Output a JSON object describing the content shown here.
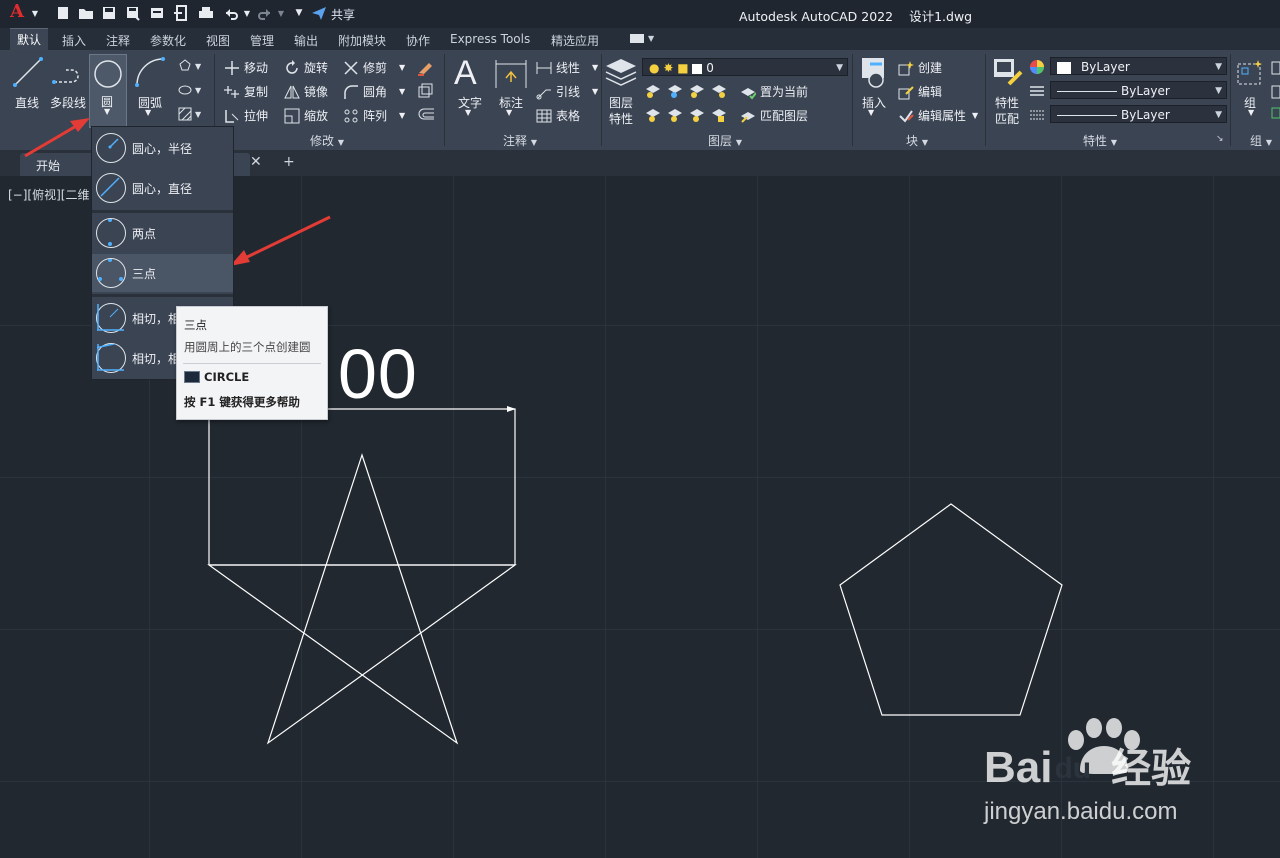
{
  "window": {
    "title": "Autodesk AutoCAD 2022",
    "file": "设计1.dwg",
    "share": "共享"
  },
  "ribbon_tabs": [
    "默认",
    "插入",
    "注释",
    "参数化",
    "视图",
    "管理",
    "输出",
    "附加模块",
    "协作",
    "Express Tools",
    "精选应用"
  ],
  "draw": {
    "line": "直线",
    "polyline": "多段线",
    "circle": "圆",
    "arc": "圆弧"
  },
  "modify": {
    "title": "修改",
    "move": "移动",
    "rotate": "旋转",
    "trim": "修剪",
    "copy": "复制",
    "mirror": "镜像",
    "fillet": "圆角",
    "stretch": "拉伸",
    "scale": "缩放",
    "array": "阵列"
  },
  "annotation": {
    "title": "注释",
    "text": "文字",
    "dimension": "标注",
    "linear": "线性",
    "leader": "引线",
    "table": "表格"
  },
  "layers": {
    "title": "图层",
    "layer_props_1": "图层",
    "layer_props_2": "特性",
    "current_layer": "0",
    "set_current": "置为当前",
    "match_layer": "匹配图层"
  },
  "block": {
    "title": "块",
    "insert": "插入",
    "create": "创建",
    "edit": "编辑",
    "edit_attrs": "编辑属性"
  },
  "properties": {
    "title": "特性",
    "match_1": "特性",
    "match_2": "匹配",
    "color": "ByLayer",
    "linetype": "ByLayer",
    "lineweight": "ByLayer"
  },
  "groups": {
    "title": "组",
    "group": "组"
  },
  "file_tabs": {
    "start": "开始"
  },
  "viewport": {
    "label": "[−][俯视][二维"
  },
  "circle_menu": {
    "center_radius": "圆心，半径",
    "center_diameter": "圆心，直径",
    "two_point": "两点",
    "three_point": "三点",
    "ttr": "相切，相",
    "ttt": "相切，相"
  },
  "tooltip": {
    "title": "三点",
    "desc": "用圆周上的三个点创建圆",
    "command": "CIRCLE",
    "help": "按 F1 键获得更多帮助"
  },
  "drawing": {
    "dimension_text": "00"
  },
  "watermark": {
    "brand": "Bai",
    "brand2": "du",
    "brand3": "经验",
    "url": "jingyan.baidu.com"
  }
}
